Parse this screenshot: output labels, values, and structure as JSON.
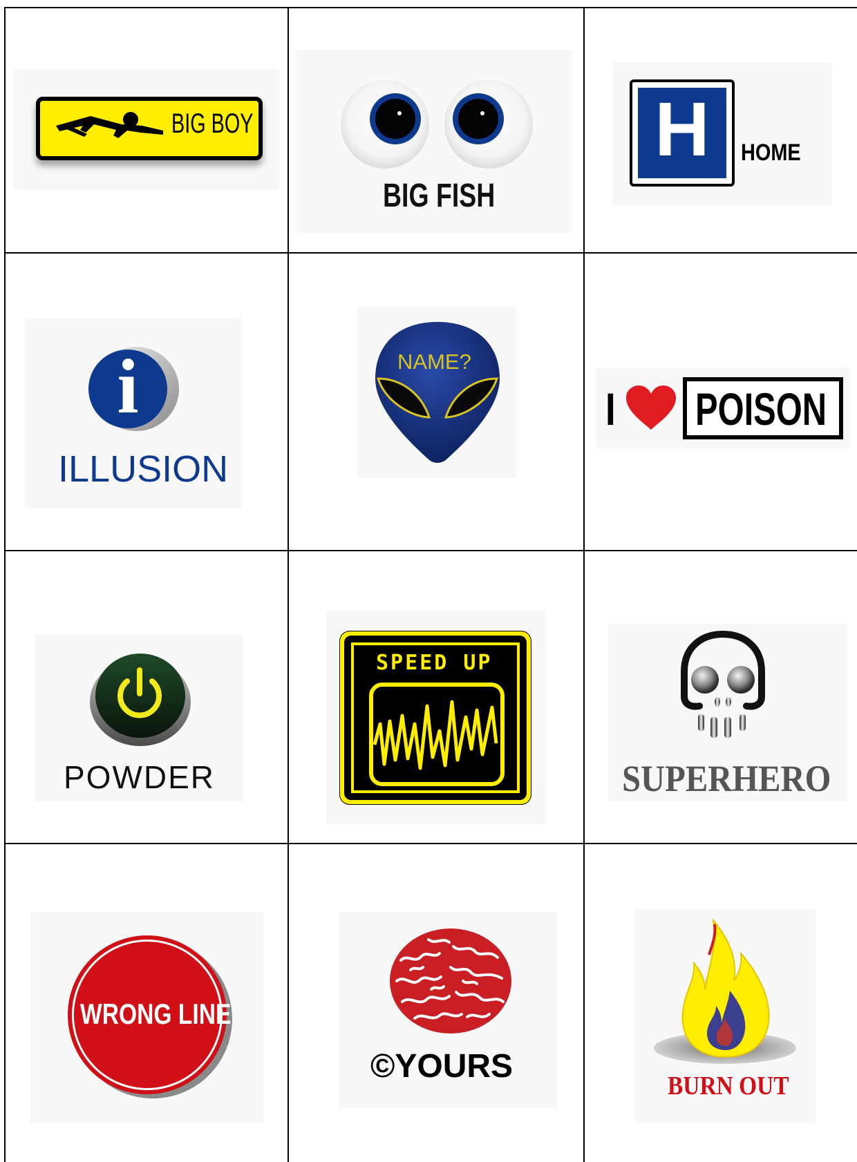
{
  "cards": [
    {
      "label": "BIG BOY"
    },
    {
      "label": "BIG FISH"
    },
    {
      "label": "HOME",
      "badge": "H"
    },
    {
      "label": "ILLUSION",
      "badge": "i"
    },
    {
      "label": "NAME?"
    },
    {
      "prefix": "I",
      "label": "POISON"
    },
    {
      "label": "POWDER"
    },
    {
      "label": "SPEED UP"
    },
    {
      "label": "SUPERHERO"
    },
    {
      "label": "WRONG LINE"
    },
    {
      "label": "©YOURS"
    },
    {
      "label": "BURN OUT"
    }
  ],
  "colors": {
    "yellow": "#ffee00",
    "navy": "#0d3a8f",
    "red": "#d10f17",
    "dark_green": "#16301c",
    "gray": "#555555"
  }
}
